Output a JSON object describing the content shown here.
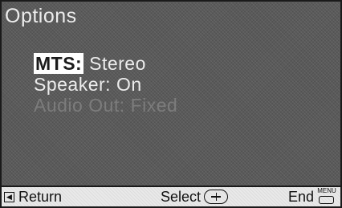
{
  "title": "Options",
  "menu": {
    "items": [
      {
        "label": "MTS:",
        "value": "Stereo"
      },
      {
        "label": "Speaker:",
        "value": "On"
      },
      {
        "label": "Audio Out:",
        "value": "Fixed"
      }
    ]
  },
  "footer": {
    "return_label": "Return",
    "select_label": "Select",
    "end_label": "End",
    "menu_key_label": "MENU"
  },
  "icons": {
    "return": "return-arrow-icon",
    "select": "joystick-icon",
    "end": "menu-button-icon"
  }
}
